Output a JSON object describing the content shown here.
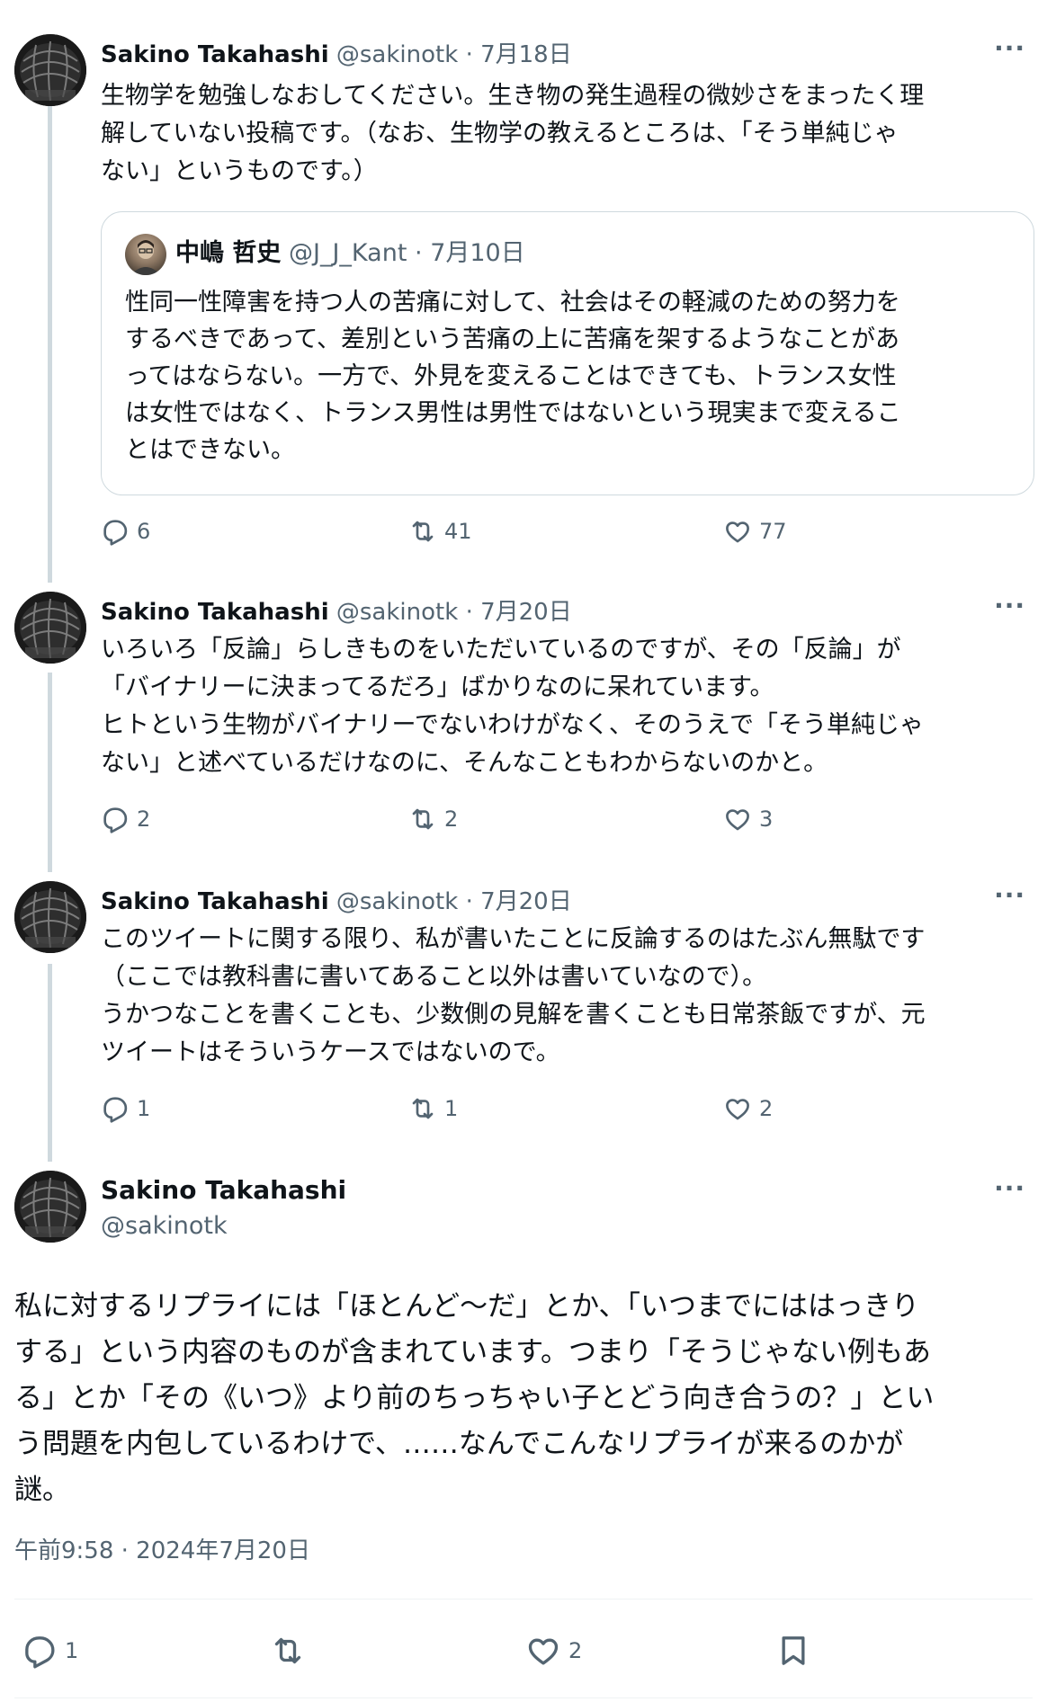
{
  "tweets": [
    {
      "name": "Sakino Takahashi",
      "handle": "@sakinotk",
      "sep": "·",
      "date": "7月18日",
      "more": "···",
      "text": "生物学を勉強しなおしてください。生き物の発生過程の微妙さをまったく理\n解していない投稿です。（なお、生物学の教えるところは、「そう単純じゃ\nない」というものです。）",
      "quote": {
        "name": "中嶋 哲史",
        "handle": "@J_J_Kant",
        "sep": "·",
        "date": "7月10日",
        "text": "性同一性障害を持つ人の苦痛に対して、社会はその軽減のための努力を\nするべきであって、差別という苦痛の上に苦痛を架するようなことがあ\nってはならない。一方で、外見を変えることはできても、トランス女性\nは女性ではなく、トランス男性は男性ではないという現実まで変えるこ\nとはできない。"
      },
      "replies": "6",
      "retweets": "41",
      "likes": "77"
    },
    {
      "name": "Sakino Takahashi",
      "handle": "@sakinotk",
      "sep": "·",
      "date": "7月20日",
      "more": "···",
      "text": "いろいろ「反論」らしきものをいただいているのですが、その「反論」が\n「バイナリーに決まってるだろ」ばかりなのに呆れています。\nヒトという生物がバイナリーでないわけがなく、そのうえで「そう単純じゃ\nない」と述べているだけなのに、そんなこともわからないのかと。",
      "replies": "2",
      "retweets": "2",
      "likes": "3"
    },
    {
      "name": "Sakino Takahashi",
      "handle": "@sakinotk",
      "sep": "·",
      "date": "7月20日",
      "more": "···",
      "text": "このツイートに関する限り、私が書いたことに反論するのはたぶん無駄です\n（ここでは教科書に書いてあること以外は書いていなので）。\nうかつなことを書くことも、少数側の見解を書くことも日常茶飯ですが、元\nツイートはそういうケースではないので。",
      "replies": "1",
      "retweets": "1",
      "likes": "2"
    }
  ],
  "main": {
    "name": "Sakino Takahashi",
    "handle": "@sakinotk",
    "more": "···",
    "text": "私に対するリプライには「ほとんど〜だ」とか、「いつまでにははっきり\nする」という内容のものが含まれています。つまり「そうじゃない例もあ\nる」とか「その《いつ》より前のちっちゃい子とどう向き合うの？」とい\nう問題を内包しているわけで、……なんでこんなリプライが来るのかが\n謎。",
    "timestamp": "午前9:58 · 2024年7月20日",
    "replies": "1",
    "likes": "2"
  },
  "icons": {
    "reply": "reply-icon",
    "retweet": "retweet-icon",
    "like": "heart-icon",
    "bookmark": "bookmark-icon",
    "more": "more-icon"
  },
  "colors": {
    "text": "#0f1419",
    "secondary": "#536471",
    "border": "#cfd9de"
  }
}
